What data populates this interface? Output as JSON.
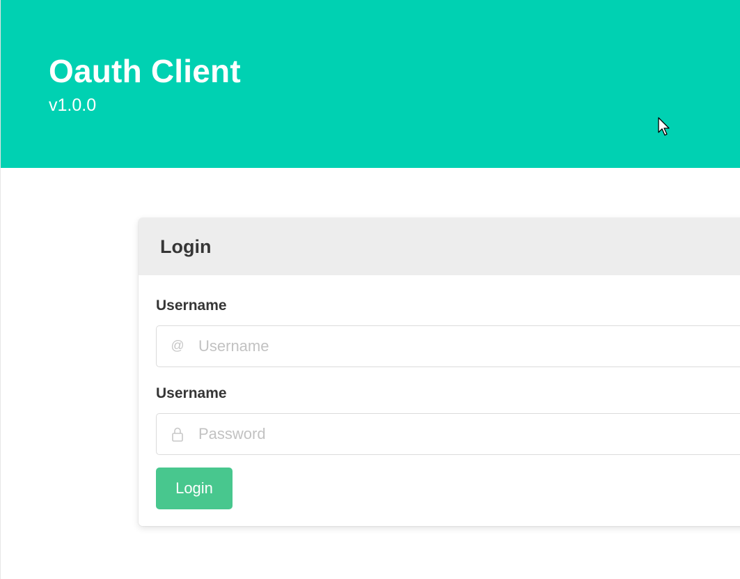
{
  "hero": {
    "title": "Oauth Client",
    "subtitle": "v1.0.0",
    "background_color": "#00d1b2"
  },
  "login_card": {
    "title": "Login",
    "username_label": "Username",
    "username_placeholder": "Username",
    "username_icon": "at-sign-icon",
    "password_label": "Username",
    "password_placeholder": "Password",
    "password_icon": "lock-icon",
    "submit_label": "Login",
    "submit_color": "#48c78e"
  }
}
